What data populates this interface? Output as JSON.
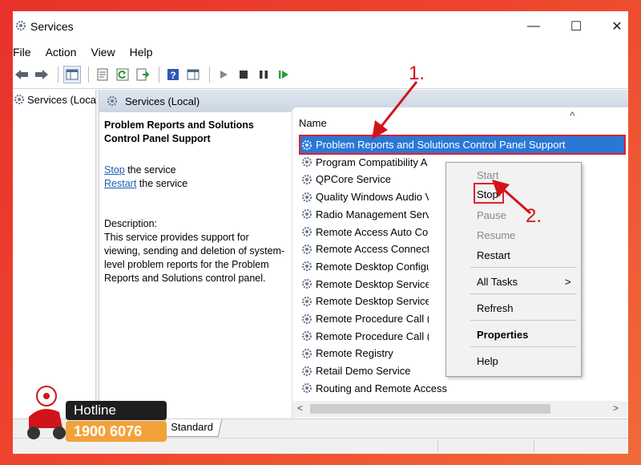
{
  "window": {
    "title": "Services",
    "minimize": "—",
    "maximize": "☐",
    "close": "✕"
  },
  "menu": [
    "File",
    "Action",
    "View",
    "Help"
  ],
  "toolbar": {
    "icons": [
      "back-arrow-icon",
      "forward-arrow-icon",
      "show-hide-console-tree-icon",
      "properties-icon",
      "refresh-icon",
      "export-list-icon",
      "help-icon",
      "show-action-pane-icon",
      "start-service-icon",
      "stop-service-icon",
      "pause-service-icon",
      "restart-service-icon"
    ]
  },
  "tree": {
    "item": "Services (Loca"
  },
  "header": {
    "title": "Services (Local)"
  },
  "description": {
    "service_name": "Problem Reports and Solutions Control Panel Support",
    "stop_link": "Stop",
    "stop_suffix": " the service",
    "restart_link": "Restart",
    "restart_suffix": " the service",
    "label": "Description:",
    "text": "This service provides support for viewing, sending and deletion of system-level problem reports for the Problem Reports and Solutions control panel."
  },
  "list": {
    "column": "Name",
    "sort_caret": "^",
    "rows": [
      "Problem Reports and Solutions Control Panel Support",
      "Program Compatibility A",
      "QPCore Service",
      "Quality Windows Audio V",
      "Radio Management Serv",
      "Remote Access Auto Cor",
      "Remote Access Connecti",
      "Remote Desktop Configu",
      "Remote Desktop Services",
      "Remote Desktop Services",
      "Remote Procedure Call (I",
      "Remote Procedure Call (I",
      "Remote Registry",
      "Retail Demo Service",
      "Routing and Remote Access"
    ],
    "selected_index": 0,
    "scroll_left": "<",
    "scroll_right": ">"
  },
  "context_menu": {
    "items": [
      {
        "label": "Start",
        "enabled": false
      },
      {
        "label": "Stop",
        "enabled": true
      },
      {
        "label": "Pause",
        "enabled": false
      },
      {
        "label": "Resume",
        "enabled": false
      },
      {
        "label": "Restart",
        "enabled": true
      },
      {
        "label": "All Tasks",
        "enabled": true
      },
      {
        "label": "Refresh",
        "enabled": true
      },
      {
        "label": "Properties",
        "enabled": true
      },
      {
        "label": "Help",
        "enabled": true
      }
    ],
    "submenu_arrow": ">"
  },
  "annotations": {
    "step1": "1.",
    "step2": "2."
  },
  "tabs": {
    "standard": "Standard"
  },
  "hotline": {
    "label": "Hotline",
    "number": "1900 6076"
  },
  "colors": {
    "selection": "#2b77d6",
    "highlight_red": "#e0202a",
    "link": "#1a5fb4",
    "hotline_orange": "#f2a23a"
  }
}
